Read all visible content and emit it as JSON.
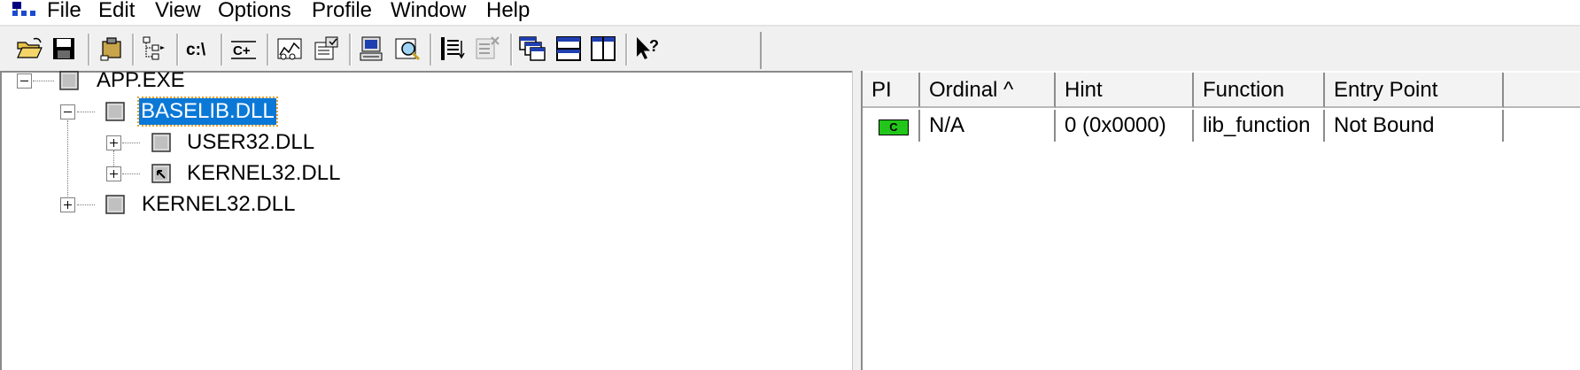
{
  "menu": {
    "items": [
      "File",
      "Edit",
      "View",
      "Options",
      "Profile",
      "Window",
      "Help"
    ]
  },
  "toolbar": {
    "buttons": [
      {
        "name": "open-icon"
      },
      {
        "name": "save-icon"
      },
      {
        "name": "copy-icon"
      },
      {
        "name": "tree-view-icon"
      },
      {
        "name": "full-paths-icon",
        "label": "c:\\"
      },
      {
        "name": "undecorate-cpp-icon",
        "label": "C+"
      },
      {
        "name": "module-functions-icon"
      },
      {
        "name": "properties-icon"
      },
      {
        "name": "system-info-icon"
      },
      {
        "name": "find-icon"
      },
      {
        "name": "sort-icon"
      },
      {
        "name": "external-viewer-icon"
      },
      {
        "name": "cascade-icon"
      },
      {
        "name": "tile-horizontal-icon"
      },
      {
        "name": "tile-vertical-icon"
      },
      {
        "name": "help-icon"
      }
    ]
  },
  "tree": {
    "nodes": [
      {
        "label": "APP.EXE",
        "expander": "minus"
      },
      {
        "label": "BASELIB.DLL",
        "expander": "minus",
        "selected": true
      },
      {
        "label": "USER32.DLL",
        "expander": "plus"
      },
      {
        "label": "KERNEL32.DLL",
        "expander": "plus",
        "icon": "forwarded"
      },
      {
        "label": "KERNEL32.DLL",
        "expander": "plus"
      }
    ]
  },
  "list": {
    "columns": [
      "PI",
      "Ordinal ^",
      "Hint",
      "Function",
      "Entry Point"
    ],
    "rows": [
      {
        "pi": "C",
        "ordinal": "N/A",
        "hint": "0 (0x0000)",
        "function": "lib_function",
        "entry_point": "Not Bound"
      }
    ]
  },
  "colors": {
    "selection": "#0a78d7",
    "c_badge": "#22c61a"
  }
}
